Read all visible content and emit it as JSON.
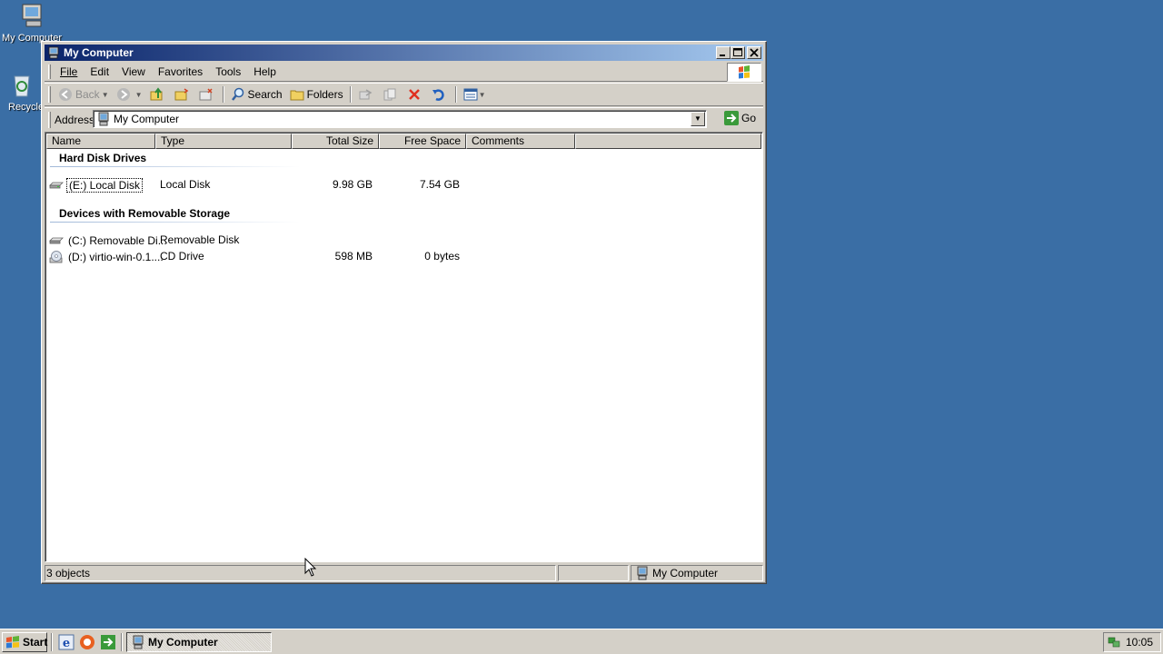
{
  "desktop": {
    "icons": [
      {
        "label": "My Computer"
      },
      {
        "label": "Recycle Bin"
      }
    ]
  },
  "window": {
    "title": "My Computer",
    "menu": [
      "File",
      "Edit",
      "View",
      "Favorites",
      "Tools",
      "Help"
    ],
    "toolbar": {
      "back": "Back",
      "search": "Search",
      "folders": "Folders"
    },
    "address": {
      "label": "Address",
      "value": "My Computer",
      "go": "Go"
    },
    "columns": [
      "Name",
      "Type",
      "Total Size",
      "Free Space",
      "Comments"
    ],
    "groups": [
      {
        "title": "Hard Disk Drives",
        "items": [
          {
            "name": "(E:) Local Disk",
            "type": "Local Disk",
            "total": "9.98 GB",
            "free": "7.54 GB"
          }
        ]
      },
      {
        "title": "Devices with Removable Storage",
        "items": [
          {
            "name": "(C:) Removable Di...",
            "type": "Removable Disk",
            "total": "",
            "free": ""
          },
          {
            "name": "(D:) virtio-win-0.1....",
            "type": "CD Drive",
            "total": "598 MB",
            "free": "0 bytes"
          }
        ]
      }
    ],
    "status": {
      "objects": "3 objects",
      "location": "My Computer"
    }
  },
  "taskbar": {
    "start": "Start",
    "task": "My Computer",
    "clock": "10:05"
  },
  "colors": {
    "desktop": "#3a6ea5",
    "title_start": "#0a246a",
    "title_end": "#a6caf0",
    "face": "#d4d0c8"
  }
}
